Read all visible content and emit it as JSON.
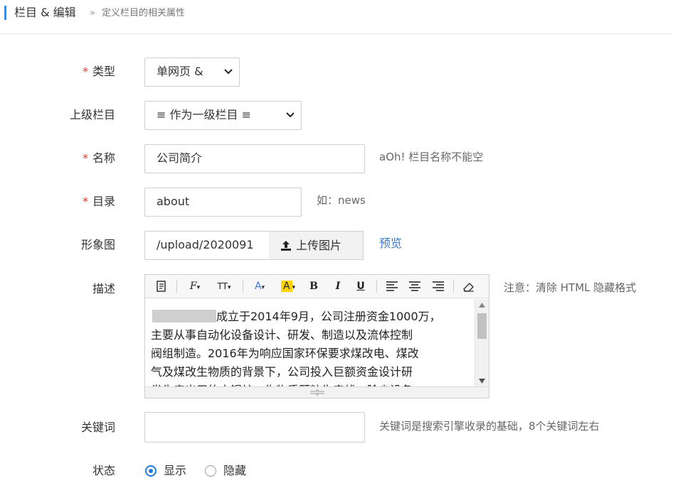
{
  "breadcrumb": {
    "main": "栏目 & 编辑",
    "separator": "»",
    "sub": "定义栏目的相关属性"
  },
  "form": {
    "type": {
      "required_mark": "*",
      "label": "类型",
      "value": "单网页 &"
    },
    "parent": {
      "label": "上级栏目",
      "value": "≡ 作为一级栏目 ≡"
    },
    "name": {
      "required_mark": "*",
      "label": "名称",
      "value": "公司简介",
      "hint": "aOh! 栏目名称不能空"
    },
    "dir": {
      "required_mark": "*",
      "label": "目录",
      "value": "about",
      "hint": "如：news"
    },
    "image": {
      "label": "形象图",
      "value": "/upload/2020091",
      "upload_label": "上传图片",
      "preview_label": "预览"
    },
    "desc": {
      "label": "描述",
      "hint": "注意：清除 HTML 隐藏格式",
      "toolbar": {
        "source_icon": "source-code-icon",
        "font_label": "F",
        "size_label": "TT",
        "font_color_label": "A",
        "bg_color_label": "A",
        "bold_label": "B",
        "italic_label": "I",
        "underline_label": "U",
        "accent": "#3b78d8",
        "highlight": "#ffd400"
      },
      "content_lead": "成立于2014年9月，公司注册资金1000万，",
      "content_lines": [
        "主要从事自动化设备设计、研发、制造以及流体控制",
        "阀组制造。2016年为响应国家环保要求煤改电、煤改",
        "气及煤改生物质的背景下，公司投入巨额资金设计研",
        "发生产出用的大锅炉，生物质颗粒生产线，除尘设备"
      ]
    },
    "keywords": {
      "label": "关键词",
      "value": "",
      "hint": "关键词是搜索引擎收录的基础，8个关键词左右"
    },
    "status": {
      "label": "状态",
      "option_show": "显示",
      "option_hide": "隐藏",
      "selected": "显示"
    }
  }
}
